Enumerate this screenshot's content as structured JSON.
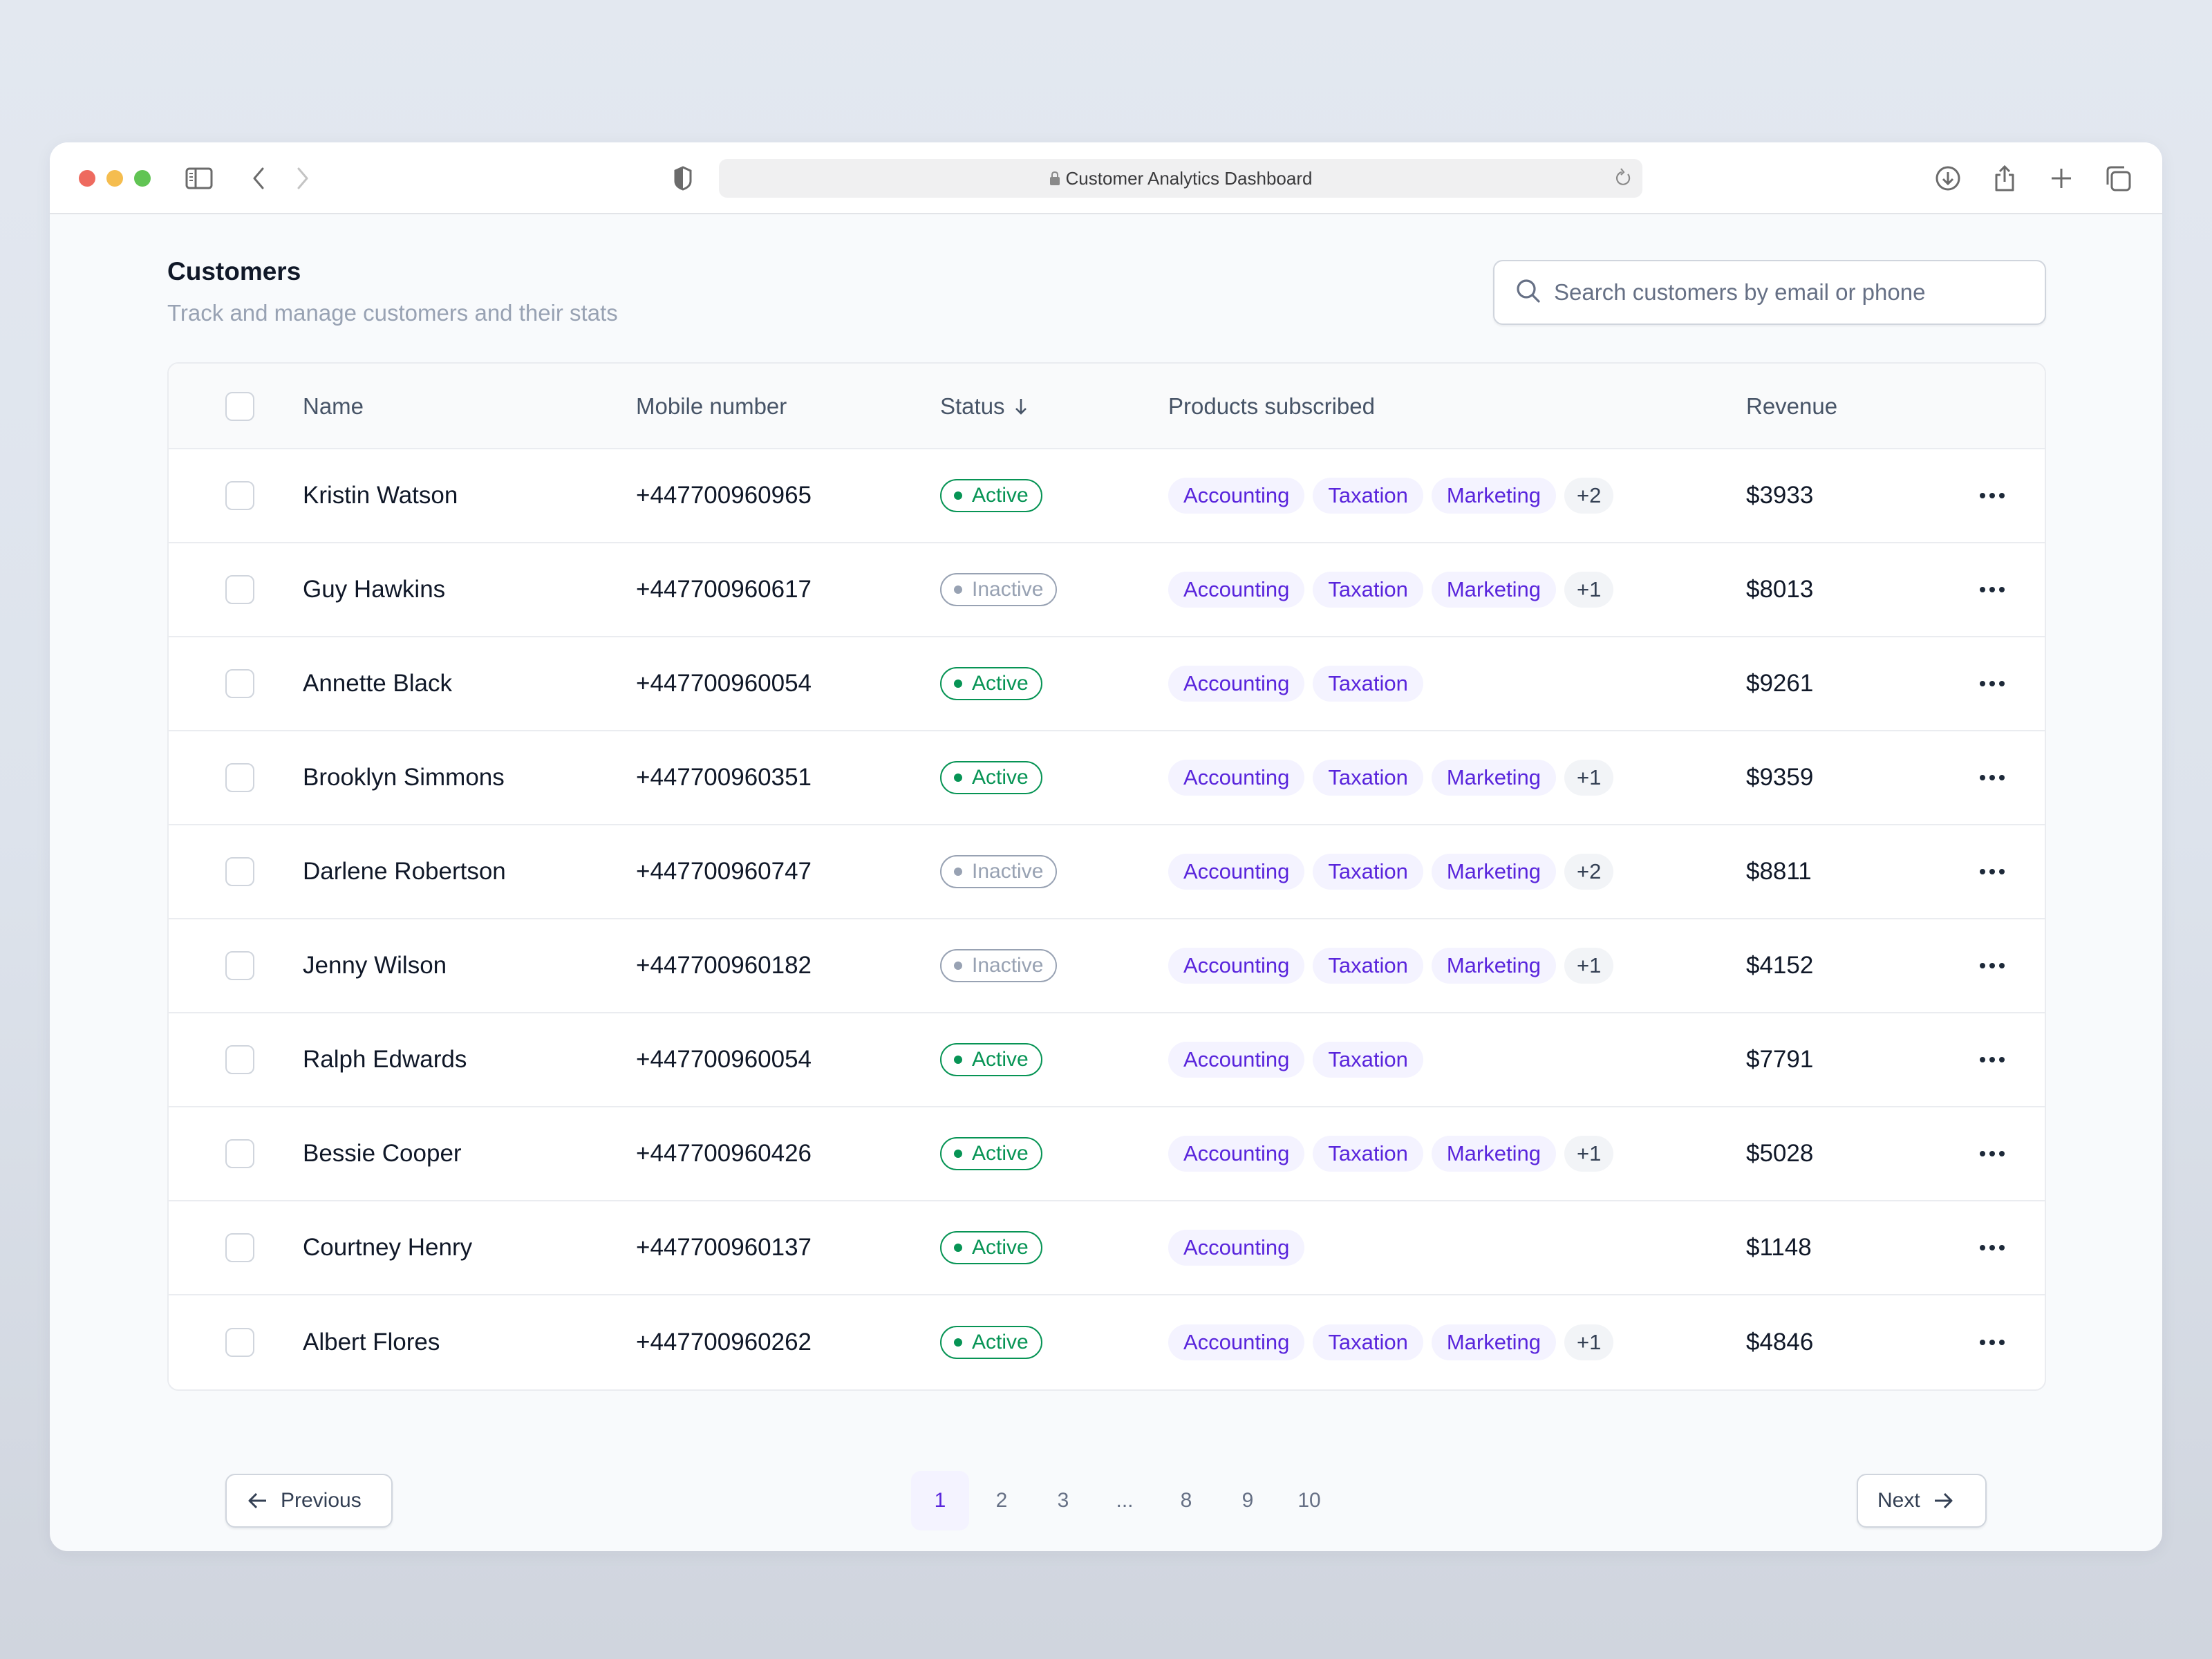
{
  "browser": {
    "address_text": "Customer Analytics Dashboard",
    "icons": [
      "sidebar-icon",
      "back-icon",
      "forward-icon",
      "shield-icon",
      "lock-icon",
      "reload-icon",
      "download-icon",
      "share-icon",
      "new-tab-icon",
      "tabs-overview-icon"
    ]
  },
  "header": {
    "title": "Customers",
    "subtitle": "Track and manage customers and their stats"
  },
  "search": {
    "placeholder": "Search customers by email or phone",
    "value": ""
  },
  "table": {
    "columns": {
      "name": "Name",
      "mobile": "Mobile number",
      "status": "Status",
      "status_sort": "descending",
      "products": "Products subscribed",
      "revenue": "Revenue"
    },
    "rows": [
      {
        "name": "Kristin Watson",
        "mobile": "+447700960965",
        "status": "Active",
        "products": [
          "Accounting",
          "Taxation",
          "Marketing"
        ],
        "more": "+2",
        "revenue": "$3933"
      },
      {
        "name": "Guy Hawkins",
        "mobile": "+447700960617",
        "status": "Inactive",
        "products": [
          "Accounting",
          "Taxation",
          "Marketing"
        ],
        "more": "+1",
        "revenue": "$8013"
      },
      {
        "name": "Annette Black",
        "mobile": "+447700960054",
        "status": "Active",
        "products": [
          "Accounting",
          "Taxation"
        ],
        "more": "",
        "revenue": "$9261"
      },
      {
        "name": "Brooklyn Simmons",
        "mobile": "+447700960351",
        "status": "Active",
        "products": [
          "Accounting",
          "Taxation",
          "Marketing"
        ],
        "more": "+1",
        "revenue": "$9359"
      },
      {
        "name": "Darlene Robertson",
        "mobile": "+447700960747",
        "status": "Inactive",
        "products": [
          "Accounting",
          "Taxation",
          "Marketing"
        ],
        "more": "+2",
        "revenue": "$8811"
      },
      {
        "name": "Jenny Wilson",
        "mobile": "+447700960182",
        "status": "Inactive",
        "products": [
          "Accounting",
          "Taxation",
          "Marketing"
        ],
        "more": "+1",
        "revenue": "$4152"
      },
      {
        "name": "Ralph Edwards",
        "mobile": "+447700960054",
        "status": "Active",
        "products": [
          "Accounting",
          "Taxation"
        ],
        "more": "",
        "revenue": "$7791"
      },
      {
        "name": "Bessie Cooper",
        "mobile": "+447700960426",
        "status": "Active",
        "products": [
          "Accounting",
          "Taxation",
          "Marketing"
        ],
        "more": "+1",
        "revenue": "$5028"
      },
      {
        "name": "Courtney Henry",
        "mobile": "+447700960137",
        "status": "Active",
        "products": [
          "Accounting"
        ],
        "more": "",
        "revenue": "$1148"
      },
      {
        "name": "Albert Flores",
        "mobile": "+447700960262",
        "status": "Active",
        "products": [
          "Accounting",
          "Taxation",
          "Marketing"
        ],
        "more": "+1",
        "revenue": "$4846"
      }
    ]
  },
  "pagination": {
    "previous_label": "Previous",
    "next_label": "Next",
    "pages": [
      "1",
      "2",
      "3",
      "...",
      "8",
      "9",
      "10"
    ],
    "current_page": "1"
  },
  "colors": {
    "accent": "#5925dc",
    "tag_bg": "#f4f3ff",
    "active": "#079455",
    "inactive": "#98a2b3"
  }
}
